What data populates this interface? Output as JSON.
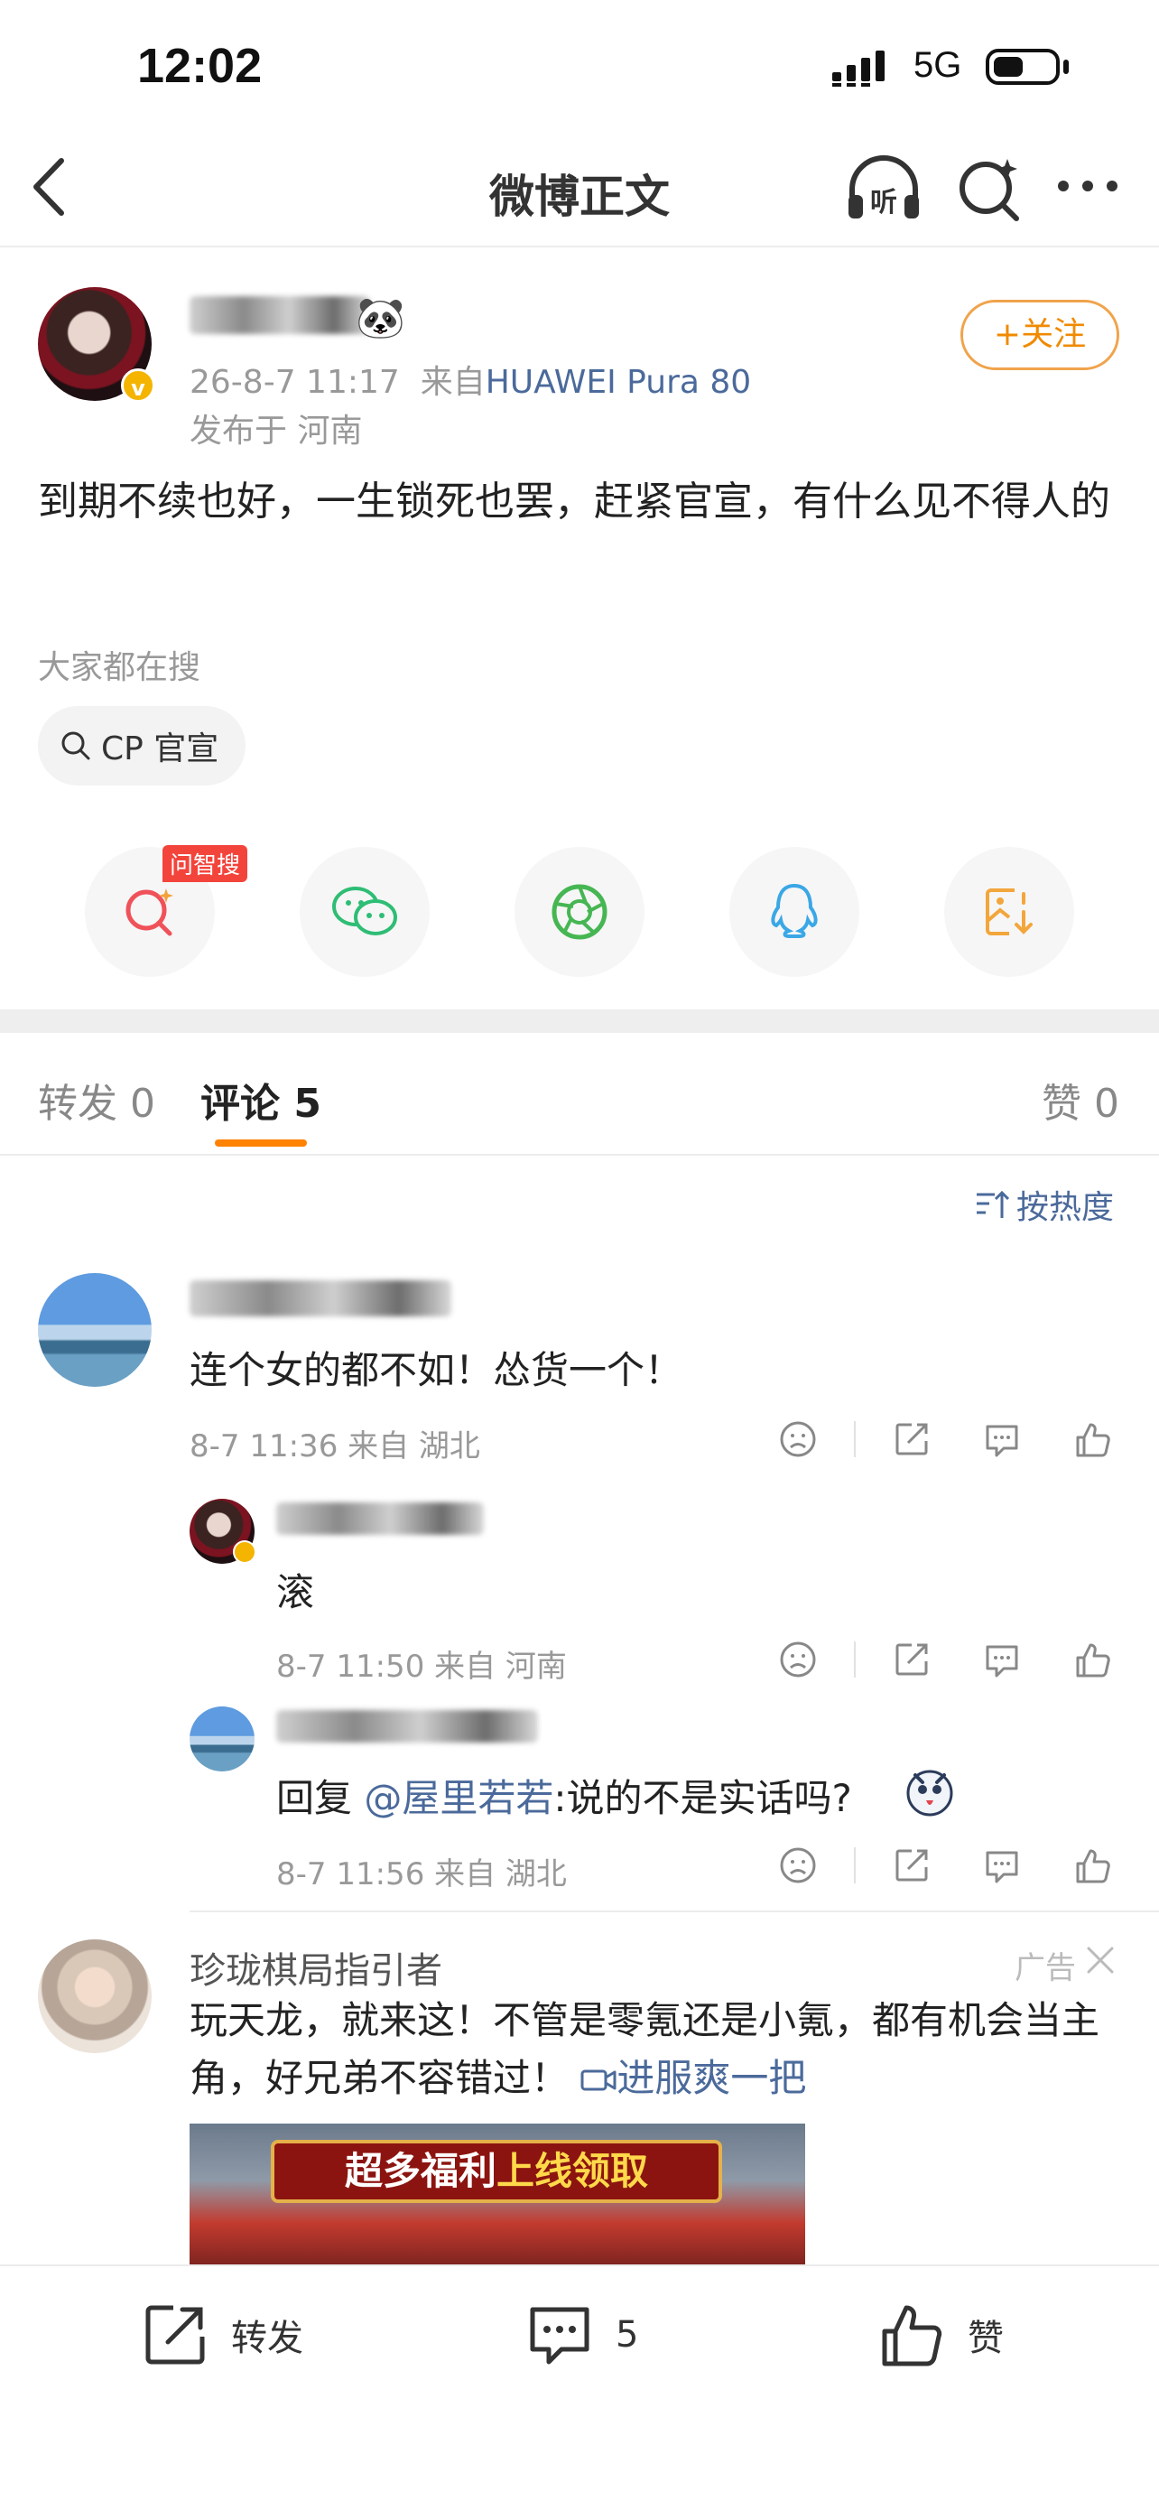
{
  "status_bar": {
    "time": "12:02",
    "network": "5G"
  },
  "nav": {
    "title": "微博正文"
  },
  "post": {
    "author_emoji": "🐼",
    "meta_time": "26-8-7 11:17",
    "meta_from": "来自",
    "meta_device": "HUAWEI Pura 80",
    "location": "发布于 河南",
    "follow_label": "+关注",
    "body": "到期不续也好，一生锁死也罢，赶紧官宣，有什么见不得人的",
    "search_hint": "大家都在搜",
    "search_chip": "CP 官宣",
    "ask_badge": "问智搜"
  },
  "tabs": {
    "reposts": "转发 0",
    "comments": "评论 5",
    "likes": "赞 0"
  },
  "sort_label": "按热度",
  "comments": [
    {
      "text": "连个女的都不如！怂货一个！",
      "meta": "8-7 11:36  来自 湖北"
    },
    {
      "text": "滚",
      "meta": "8-7 11:50  来自 河南"
    },
    {
      "reply_prefix": "回复 ",
      "mention": "@屋里若若",
      "text": ":说的不是实话吗?",
      "meta": "8-7 11:56  来自 湖北"
    }
  ],
  "ad": {
    "name": "珍珑棋局指引者",
    "label": "广告",
    "text": "玩天龙，就来这！不管是零氪还是小氪，都有机会当主角，好兄弟不容错过！",
    "link": "进服爽一把",
    "banner_a": "超多福利",
    "banner_b": "上线领取"
  },
  "bottom_bar": {
    "repost": "转发",
    "comment_count": "5",
    "like": "赞"
  },
  "colors": {
    "accent": "#ff8200",
    "link": "#4b6a9b",
    "ad_badge": "#f3443c"
  }
}
